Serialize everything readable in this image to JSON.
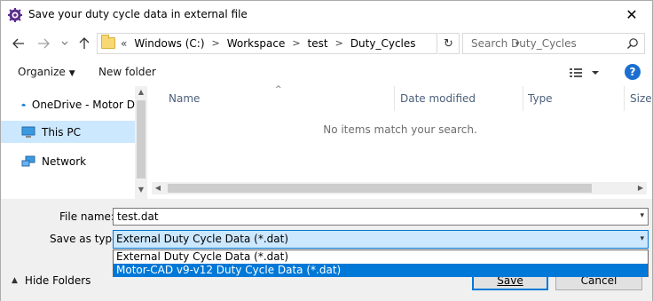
{
  "window": {
    "title": "Save your duty cycle data in external file",
    "close_glyph": "✕"
  },
  "nav": {
    "back_icon": "arrow-left-icon",
    "forward_icon": "arrow-right-icon",
    "recent_icon": "chevron-down-icon",
    "up_icon": "arrow-up-icon",
    "breadcrumb_prefix": "«",
    "breadcrumbs": [
      "Windows (C:)",
      "Workspace",
      "test",
      "Duty_Cycles"
    ],
    "search_placeholder": "Search Duty_Cycles"
  },
  "toolbar": {
    "organize_label": "Organize",
    "new_folder_label": "New folder",
    "help_label": "?"
  },
  "sidebar": {
    "items": [
      {
        "label": "OneDrive - Motor D",
        "icon": "cloud-icon"
      },
      {
        "label": "This PC",
        "icon": "computer-icon",
        "selected": true
      },
      {
        "label": "Network",
        "icon": "network-icon"
      }
    ]
  },
  "file_list": {
    "columns": [
      "Name",
      "Date modified",
      "Type",
      "Size"
    ],
    "empty_message": "No items match your search."
  },
  "form": {
    "file_name_label": "File name:",
    "file_name_value": "test.dat",
    "save_type_label": "Save as type:",
    "save_type_value": "External Duty Cycle Data (*.dat)",
    "type_options": [
      "External Duty Cycle Data (*.dat)",
      "Motor-CAD v9-v12 Duty Cycle Data (*.dat)"
    ],
    "hide_folders_label": "Hide Folders",
    "save_label": "Save",
    "cancel_label": "Cancel"
  },
  "colors": {
    "accent": "#0078d7",
    "selection": "#cce8ff",
    "header_text": "#4c607a"
  }
}
